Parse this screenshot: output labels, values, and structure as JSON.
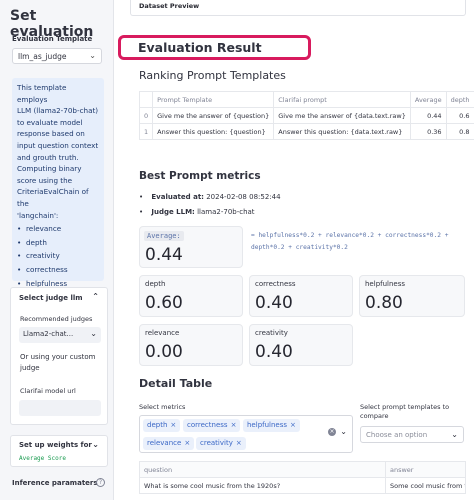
{
  "sidebar": {
    "title": "Set evaluation",
    "template_label": "Evaluation Template",
    "template_value": "llm_as_judge",
    "description": "This template employs\nLLM (llama2-70b-chat)\nto evaluate model\nresponse based on\ninput question context\nand grouth truth.\nComputing binary\nscore using the\nCriteriaEvalChain of the\n'langchain':",
    "criteria": [
      "relevance",
      "depth",
      "creativity",
      "correctness",
      "helpfulness"
    ],
    "judge_card": {
      "title": "Select judge llm",
      "recommended_label": "Recommended judges",
      "recommended_value": "Llama2-chat...",
      "or_text": "Or using your custom judge",
      "url_label": "Clarifai model url",
      "url_value": ""
    },
    "weights_card": {
      "title": "Set up weights for",
      "code": "Average Score"
    },
    "inference_label": "Inference paramaters"
  },
  "main": {
    "dataset_preview": "Dataset Preview",
    "eval_title": "Evaluation Result",
    "ranking_title": "Ranking Prompt Templates",
    "ranking_table": {
      "headers": [
        "",
        "Prompt Template",
        "Clarifai prompt",
        "Average",
        "depth",
        "correct"
      ],
      "rows": [
        [
          "0",
          "Give me the answer of {question}",
          "Give me the answer of {data.text.raw}",
          "0.44",
          "0.6",
          ""
        ],
        [
          "1",
          "Answer this question: {question}",
          "Answer this question: {data.text.raw}",
          "0.36",
          "0.8",
          ""
        ]
      ]
    },
    "best_title": "Best Prompt metrics",
    "evaluated_label": "Evaluated at:",
    "evaluated_value": "2024-02-08 08:52:44",
    "judge_label": "Judge LLM:",
    "judge_value": "llama2-70b-chat",
    "average_tag": "Average:",
    "average_value": "0.44",
    "formula": "= helpfulness*0.2 + relevance*0.2 + correctness*0.2 + depth*0.2 + creativity*0.2",
    "metrics": [
      {
        "label": "depth",
        "value": "0.60"
      },
      {
        "label": "correctness",
        "value": "0.40"
      },
      {
        "label": "helpfulness",
        "value": "0.80"
      },
      {
        "label": "relevance",
        "value": "0.00"
      },
      {
        "label": "creativity",
        "value": "0.40"
      }
    ],
    "detail_title": "Detail Table",
    "select_metrics_label": "Select metrics",
    "selected_metrics": [
      "depth",
      "correctness",
      "helpfulness",
      "relevance",
      "creativity"
    ],
    "compare_label": "Select prompt templates to compare",
    "compare_placeholder": "Choose an option",
    "detail_table": {
      "headers": [
        "question",
        "answer"
      ],
      "rows": [
        [
          "What is some cool music from the 1920s?",
          "Some cool music from th"
        ]
      ]
    }
  },
  "colors": {
    "highlight": "#d81b5e",
    "chip_bg": "#eaf0fb",
    "chip_text": "#3a67c6",
    "info_bg": "#e6eefb"
  }
}
